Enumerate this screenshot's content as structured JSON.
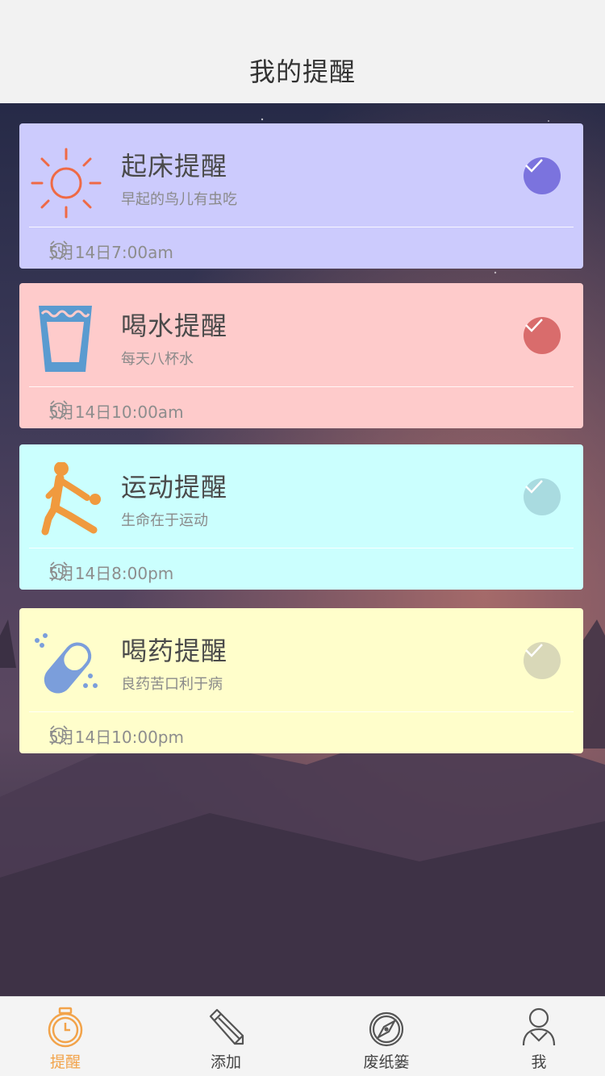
{
  "header": {
    "title": "我的提醒"
  },
  "colors": {
    "accent": "#f2a34a",
    "card_purple": "#cccbfd",
    "card_red": "#fecbcb",
    "card_cyan": "#cbfffe",
    "card_yellow": "#fffecb",
    "check_purple": "#7b73de",
    "check_red": "#d96c6c",
    "check_cyan_done": "#a9dbe0",
    "check_yellow_done": "#d9d8b8"
  },
  "reminders": [
    {
      "title": "起床提醒",
      "subtitle": "早起的鸟儿有虫吃",
      "time": "5月14日7:00am",
      "icon": "sun-icon",
      "checked": true
    },
    {
      "title": "喝水提醒",
      "subtitle": "每天八杯水",
      "time": "5月14日10:00am",
      "icon": "water-glass-icon",
      "checked": true
    },
    {
      "title": "运动提醒",
      "subtitle": "生命在于运动",
      "time": "5月14日8:00pm",
      "icon": "sports-icon",
      "checked": false
    },
    {
      "title": "喝药提醒",
      "subtitle": "良药苦口利于病",
      "time": "5月14日10:00pm",
      "icon": "pill-icon",
      "checked": false
    }
  ],
  "tabbar": {
    "items": [
      {
        "label": "提醒",
        "icon": "alarm-clock-icon",
        "active": true
      },
      {
        "label": "添加",
        "icon": "pencil-icon",
        "active": false
      },
      {
        "label": "废纸篓",
        "icon": "compass-icon",
        "active": false
      },
      {
        "label": "我",
        "icon": "user-icon",
        "active": false
      }
    ]
  }
}
